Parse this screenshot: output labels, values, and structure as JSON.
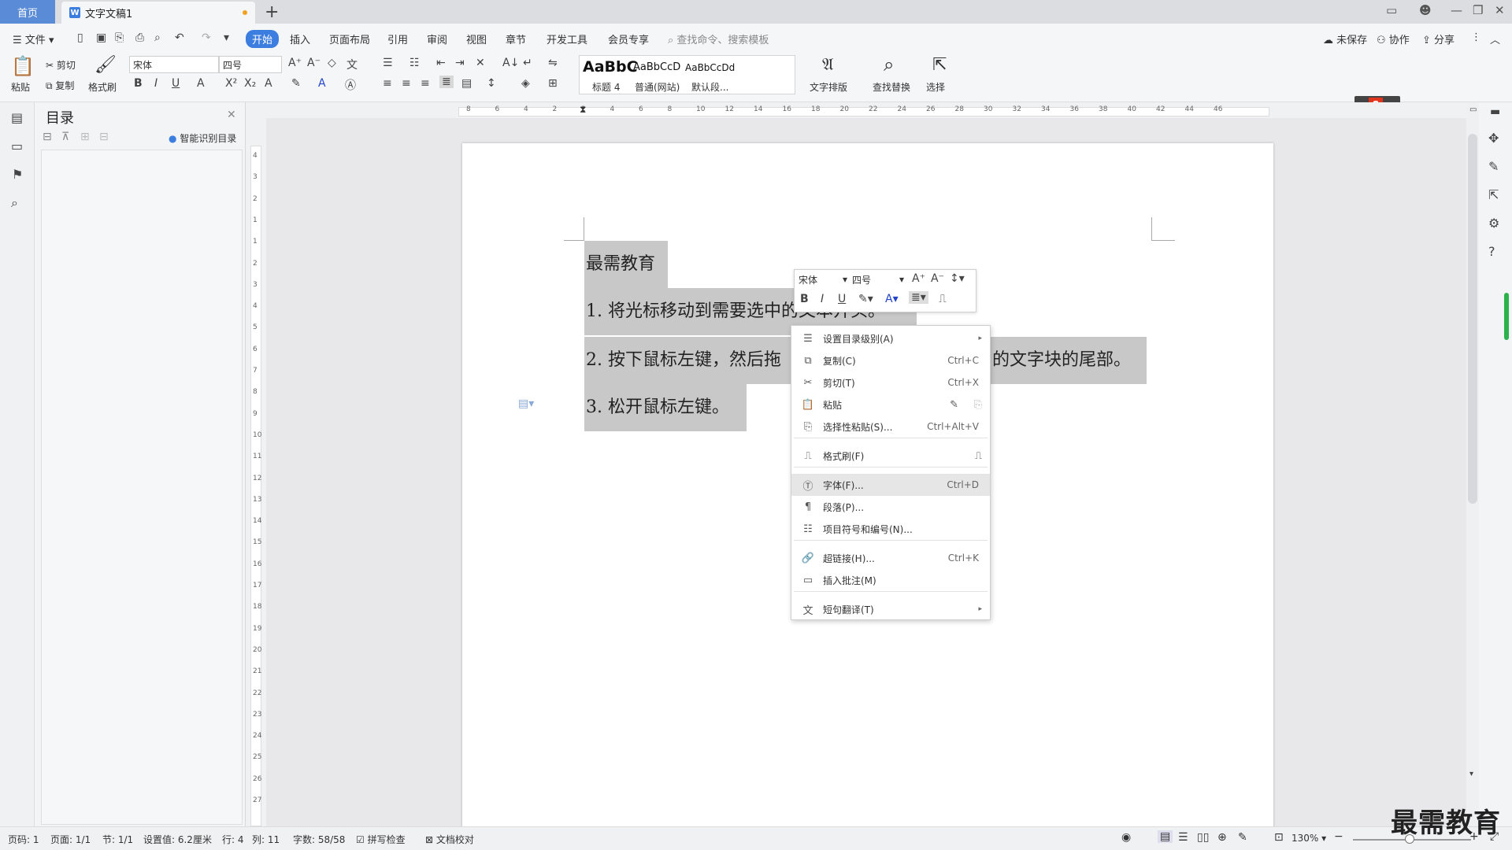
{
  "titlebar": {
    "home_tab": "首页",
    "doc_tab": "文字文稿1",
    "doc_icon": "W",
    "new_tab": "+"
  },
  "menubar": {
    "file": "文件",
    "items": [
      "开始",
      "插入",
      "页面布局",
      "引用",
      "审阅",
      "视图",
      "章节",
      "开发工具",
      "会员专享"
    ],
    "search_placeholder": "查找命令、搜索模板",
    "unsaved": "未保存",
    "collab": "协作",
    "share": "分享"
  },
  "ribbon": {
    "paste": "粘贴",
    "cut": "剪切",
    "copy": "复制",
    "format_painter": "格式刷",
    "font_name": "宋体",
    "font_size": "四号",
    "styles": [
      {
        "preview": "AaBbC",
        "label": "标题 4"
      },
      {
        "preview": "AaBbCcD",
        "label": "普通(网站)"
      },
      {
        "preview": "AaBbCcDd",
        "label": "默认段..."
      }
    ],
    "text_layout": "文字排版",
    "find_replace": "查找替换",
    "select": "选择"
  },
  "toc": {
    "title": "目录",
    "smart_recognize": "智能识别目录"
  },
  "hruler_numbers": [
    "8",
    "6",
    "4",
    "2",
    "2",
    "4",
    "6",
    "8",
    "10",
    "12",
    "14",
    "16",
    "18",
    "20",
    "22",
    "24",
    "26",
    "28",
    "30",
    "32",
    "34",
    "36",
    "38",
    "40",
    "42",
    "44",
    "46"
  ],
  "vruler_numbers": [
    "4",
    "3",
    "2",
    "1",
    "1",
    "2",
    "3",
    "4",
    "5",
    "6",
    "7",
    "8",
    "9",
    "10",
    "11",
    "12",
    "13",
    "14",
    "15",
    "16",
    "17",
    "18",
    "19",
    "20",
    "21",
    "22",
    "23",
    "24",
    "25",
    "26",
    "27"
  ],
  "document": {
    "line1": "最需教育",
    "line2a": "1. 将光标移动到需要选中",
    "line2b": "的文本开头。",
    "line3a": "2. 按下鼠标左键，然后拖",
    "line3b": "的文字块的尾部。",
    "line4": "3. 松开鼠标左键。"
  },
  "minitoolbar": {
    "font_name": "宋体",
    "font_size": "四号"
  },
  "context_menu": {
    "items": [
      {
        "label": "设置目录级别(A)",
        "shortcut": "",
        "icon": "toc-level-icon"
      },
      {
        "label": "复制(C)",
        "shortcut": "Ctrl+C",
        "icon": "copy-icon"
      },
      {
        "label": "剪切(T)",
        "shortcut": "Ctrl+X",
        "icon": "scissors-icon"
      },
      {
        "label": "粘贴",
        "shortcut": "",
        "icon": "paste-icon"
      },
      {
        "label": "选择性粘贴(S)...",
        "shortcut": "Ctrl+Alt+V",
        "icon": "paste-special-icon"
      },
      {
        "label": "格式刷(F)",
        "shortcut": "",
        "icon": "format-painter-icon"
      },
      {
        "label": "字体(F)...",
        "shortcut": "Ctrl+D",
        "icon": "font-icon"
      },
      {
        "label": "段落(P)...",
        "shortcut": "",
        "icon": "paragraph-icon"
      },
      {
        "label": "项目符号和编号(N)...",
        "shortcut": "",
        "icon": "list-icon"
      },
      {
        "label": "超链接(H)...",
        "shortcut": "Ctrl+K",
        "icon": "link-icon"
      },
      {
        "label": "插入批注(M)",
        "shortcut": "",
        "icon": "comment-icon"
      },
      {
        "label": "短句翻译(T)",
        "shortcut": "",
        "icon": "translate-icon"
      }
    ]
  },
  "statusbar": {
    "page_code": "页码: 1",
    "page": "页面: 1/1",
    "section": "节: 1/1",
    "setting": "设置值: 6.2厘米",
    "row": "行: 4",
    "col": "列: 11",
    "word_count": "字数: 58/58",
    "spell_check": "拼写检查",
    "doc_proof": "文档校对",
    "zoom": "130%"
  },
  "watermark": "最需教育",
  "colors": {
    "accent": "#3c7de0",
    "home_tab": "#5a8bd6",
    "selection": "#c8c8c8",
    "unsaved_dot": "#f0a11e"
  }
}
